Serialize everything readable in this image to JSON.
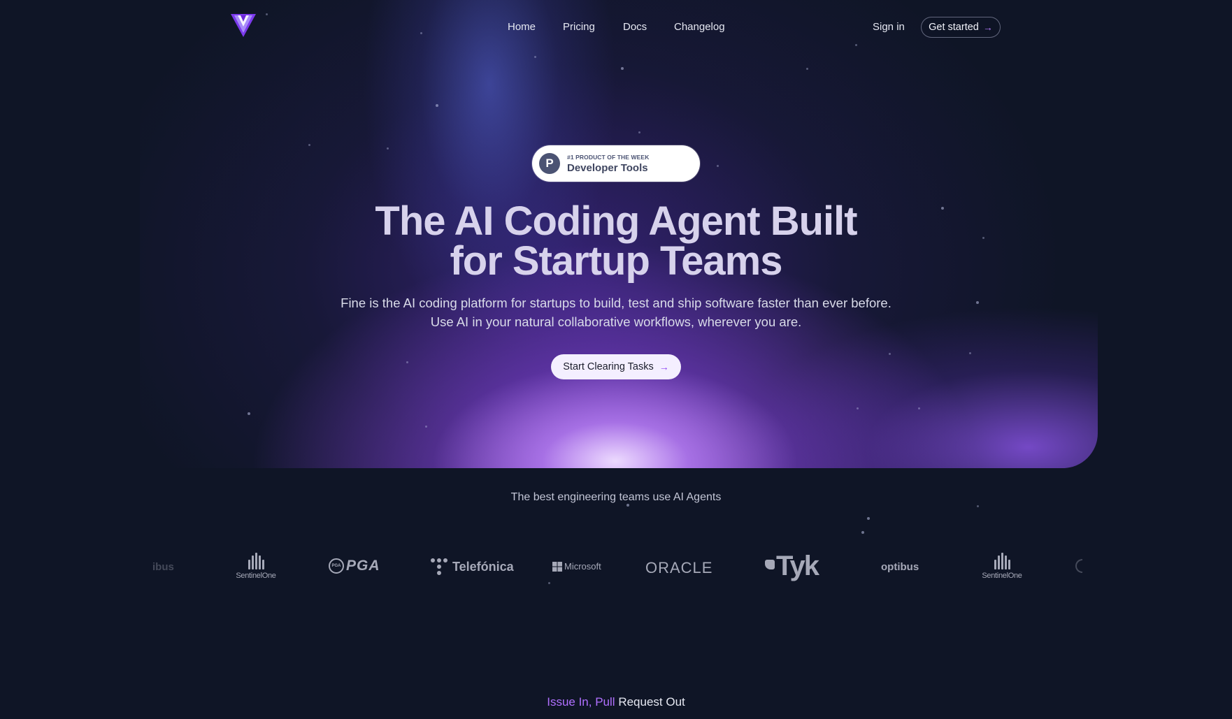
{
  "nav": {
    "links": [
      "Home",
      "Pricing",
      "Docs",
      "Changelog"
    ],
    "sign_in": "Sign in",
    "get_started": "Get started",
    "arrow": "→"
  },
  "badge": {
    "icon_letter": "P",
    "small": "#1 PRODUCT OF THE WEEK",
    "big": "Developer Tools"
  },
  "hero": {
    "headline_line1": "The AI Coding Agent Built",
    "headline_line2": "for Startup Teams",
    "subtext": "Fine is the AI coding platform for startups to build, test and ship software faster than ever before. Use AI in your natural collaborative workflows, wherever you are.",
    "cta": "Start Clearing Tasks",
    "cta_arrow": "→"
  },
  "teams_text": "The best engineering teams use AI Agents",
  "clients": {
    "optibus_partial": "ibus",
    "sentinelone": "SentinelOne",
    "pga": "PGA",
    "pga_badge": "PGA",
    "telefonica": "Telefónica",
    "microsoft": "Microsoft",
    "oracle": "ORACLE",
    "tyk": "Tyk",
    "optibus": "optibus",
    "sentinelone_2": "SentinelOne"
  },
  "section": {
    "title_purple": "Issue In,",
    "title_purple2": "Pull",
    "title_white": "Request Out"
  },
  "colors": {
    "background": "#0f1526",
    "accent": "#a855f7",
    "badge_bg": "#ffffff",
    "cta_bg": "#f4efff"
  }
}
